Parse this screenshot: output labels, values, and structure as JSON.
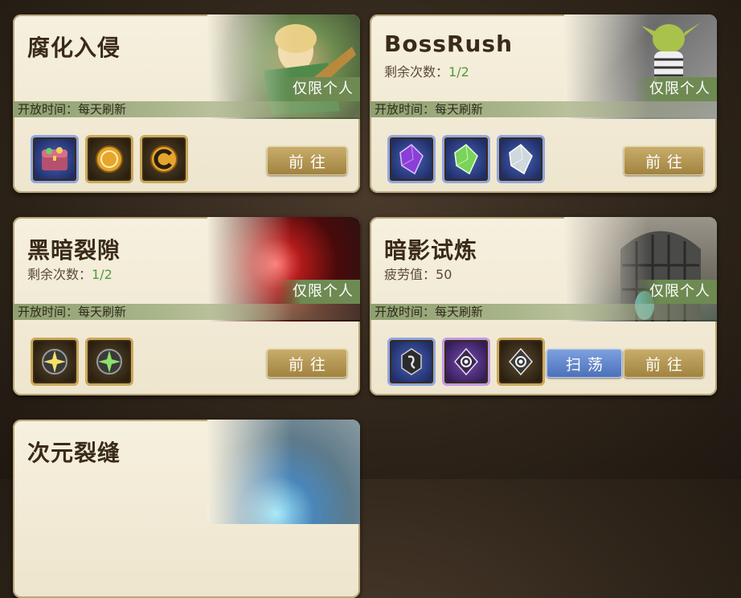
{
  "cards": [
    {
      "title": "腐化入侵",
      "tag": "仅限个人",
      "time": "开放时间：每天刷新",
      "go_label": "前往",
      "icons": [
        "treasure-chest-icon",
        "gold-coin-icon",
        "gold-coin-icon"
      ]
    },
    {
      "title": "BossRush",
      "sub_label": "剩余次数：",
      "sub_value": "1/2",
      "tag": "仅限个人",
      "time": "开放时间：每天刷新",
      "go_label": "前往",
      "icons": [
        "purple-crystal-icon",
        "green-crystal-icon",
        "white-crystal-icon"
      ]
    },
    {
      "title": "黑暗裂隙",
      "sub_label": "剩余次数：",
      "sub_value": "1/2",
      "tag": "仅限个人",
      "time": "开放时间：每天刷新",
      "go_label": "前往",
      "icons": [
        "yellow-star-gem-icon",
        "green-star-gem-icon"
      ]
    },
    {
      "title": "暗影试炼",
      "sub_label": "疲劳值：",
      "sub_value": "50",
      "tag": "仅限个人",
      "time": "开放时间：每天刷新",
      "go_label": "前往",
      "sweep_label": "扫荡",
      "icons": [
        "dark-emblem-icon",
        "eye-emblem-icon",
        "eye-emblem-icon"
      ]
    },
    {
      "title": "次元裂缝"
    }
  ],
  "colors": {
    "accent_green": "#4f9a3e",
    "go_button": "#b8984f",
    "sweep_button": "#5f83cc"
  }
}
